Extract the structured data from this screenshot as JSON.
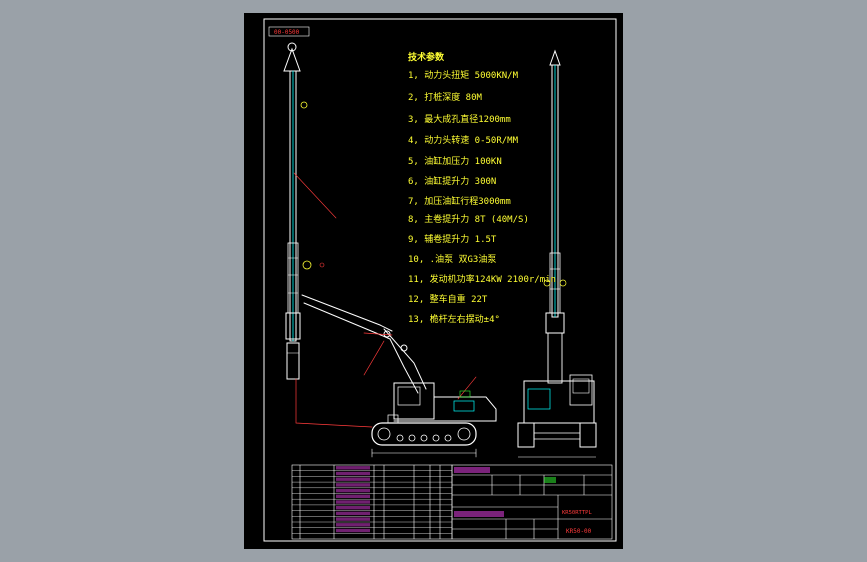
{
  "drawing": {
    "top_tag": "00-0500",
    "spec_title": "技术参数",
    "specs": [
      "1, 动力头扭矩 5000KN/M",
      "2, 打桩深度 80M",
      "3, 最大成孔直径1200mm",
      "4, 动力头转速 0-50R/MM",
      "5, 油缸加压力 100KN",
      "6, 油缸提升力 300N",
      "7, 加压油缸行程3000mm",
      "8, 主卷提升力 8T (40M/S)",
      "9, 辅卷提升力 1.5T",
      "10, .油泵 双G3油泵",
      "11, 发动机功率124KW 2100r/min",
      "12, 整车自重 22T",
      "13, 桅杆左右摆动±4°"
    ],
    "title_block": {
      "drawing_code": "KR50RTTPL",
      "model_code": "KR50-00"
    }
  },
  "colors": {
    "background": "#9aa1a8",
    "sheet": "#000000",
    "line": "#ffffff",
    "spec_text": "#ffff33",
    "dim_red": "#ff3b3b",
    "hatch_magenta": "#e040e0",
    "cyan": "#00ffff",
    "green": "#33ff33"
  }
}
